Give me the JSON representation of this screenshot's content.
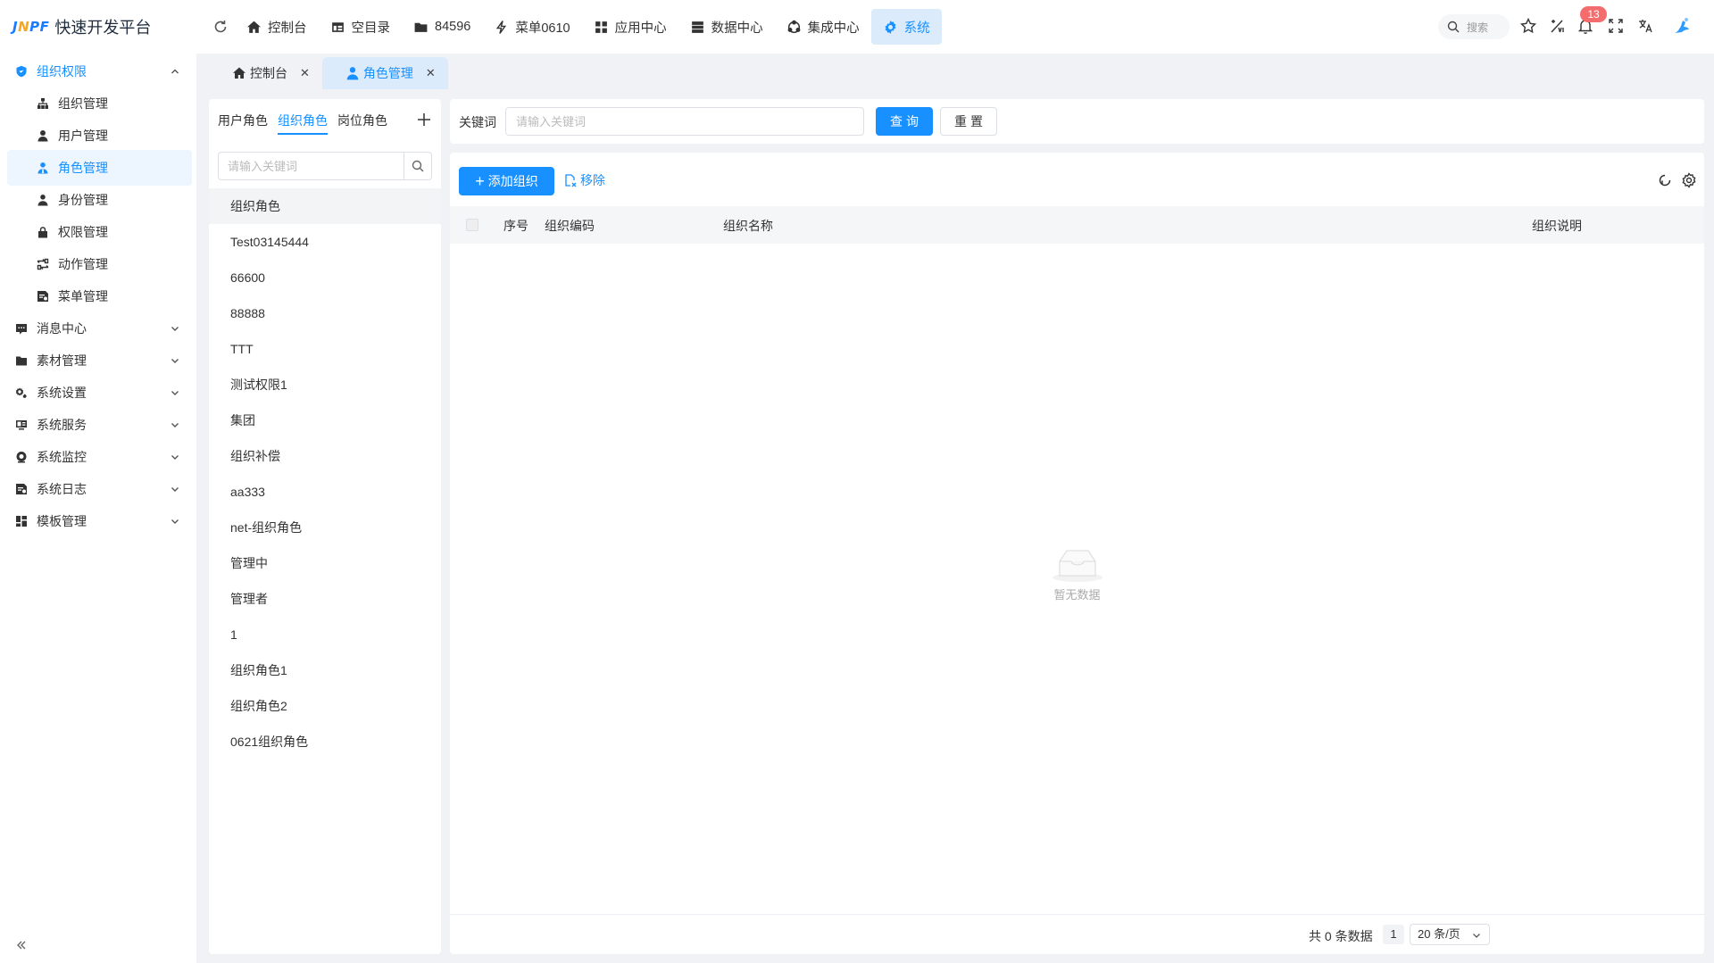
{
  "header": {
    "logo_mark": "JNPF",
    "logo_title": "快速开发平台",
    "nav": [
      {
        "label": "控制台",
        "icon": "home-icon"
      },
      {
        "label": "空目录",
        "icon": "dashboard-icon"
      },
      {
        "label": "84596",
        "icon": "folder-icon"
      },
      {
        "label": "菜单0610",
        "icon": "lightning-icon"
      },
      {
        "label": "应用中心",
        "icon": "grid-icon"
      },
      {
        "label": "数据中心",
        "icon": "database-icon"
      },
      {
        "label": "集成中心",
        "icon": "integration-icon"
      },
      {
        "label": "系统",
        "icon": "gear-icon",
        "active": true
      }
    ],
    "search_placeholder": "搜索",
    "notification_count": "13"
  },
  "sidebar": {
    "groups": [
      {
        "label": "组织权限",
        "icon": "shield-icon",
        "open": true
      },
      {
        "label": "消息中心",
        "icon": "message-icon"
      },
      {
        "label": "素材管理",
        "icon": "folder-icon"
      },
      {
        "label": "系统设置",
        "icon": "settings-icon"
      },
      {
        "label": "系统服务",
        "icon": "service-icon"
      },
      {
        "label": "系统监控",
        "icon": "monitor-icon"
      },
      {
        "label": "系统日志",
        "icon": "log-icon"
      },
      {
        "label": "模板管理",
        "icon": "template-icon"
      }
    ],
    "items": [
      {
        "label": "组织管理",
        "icon": "org-icon"
      },
      {
        "label": "用户管理",
        "icon": "user-icon"
      },
      {
        "label": "角色管理",
        "icon": "role-icon",
        "selected": true
      },
      {
        "label": "身份管理",
        "icon": "identity-icon"
      },
      {
        "label": "权限管理",
        "icon": "lock-icon"
      },
      {
        "label": "动作管理",
        "icon": "action-icon"
      },
      {
        "label": "菜单管理",
        "icon": "menu-icon"
      }
    ]
  },
  "tabs": [
    {
      "label": "控制台",
      "icon": "home-icon"
    },
    {
      "label": "角色管理",
      "icon": "role-icon",
      "active": true
    }
  ],
  "role_panel": {
    "tabs": [
      "用户角色",
      "组织角色",
      "岗位角色"
    ],
    "active_tab": "组织角色",
    "search_placeholder": "请输入关键词",
    "items": [
      "组织角色",
      "Test03145444",
      "66600",
      "88888",
      "TTT",
      "测试权限1",
      "集团",
      "组织补偿",
      "aa333",
      "net-组织角色",
      "管理中",
      "管理者",
      "1",
      "组织角色1",
      "组织角色2",
      "0621组织角色"
    ]
  },
  "query": {
    "keyword_label": "关键词",
    "keyword_placeholder": "请输入关键词",
    "search_button": "查询",
    "reset_button": "重置"
  },
  "table": {
    "add_button": "添加组织",
    "remove_button": "移除",
    "columns": [
      "序号",
      "组织编码",
      "组织名称",
      "组织说明"
    ],
    "empty_text": "暂无数据"
  },
  "pagination": {
    "total": "共 0 条数据",
    "page": "1",
    "page_size": "20 条/页"
  },
  "colors": {
    "primary": "#1890ff",
    "badge": "#f56c6c",
    "active_bg": "#dcebfc"
  }
}
